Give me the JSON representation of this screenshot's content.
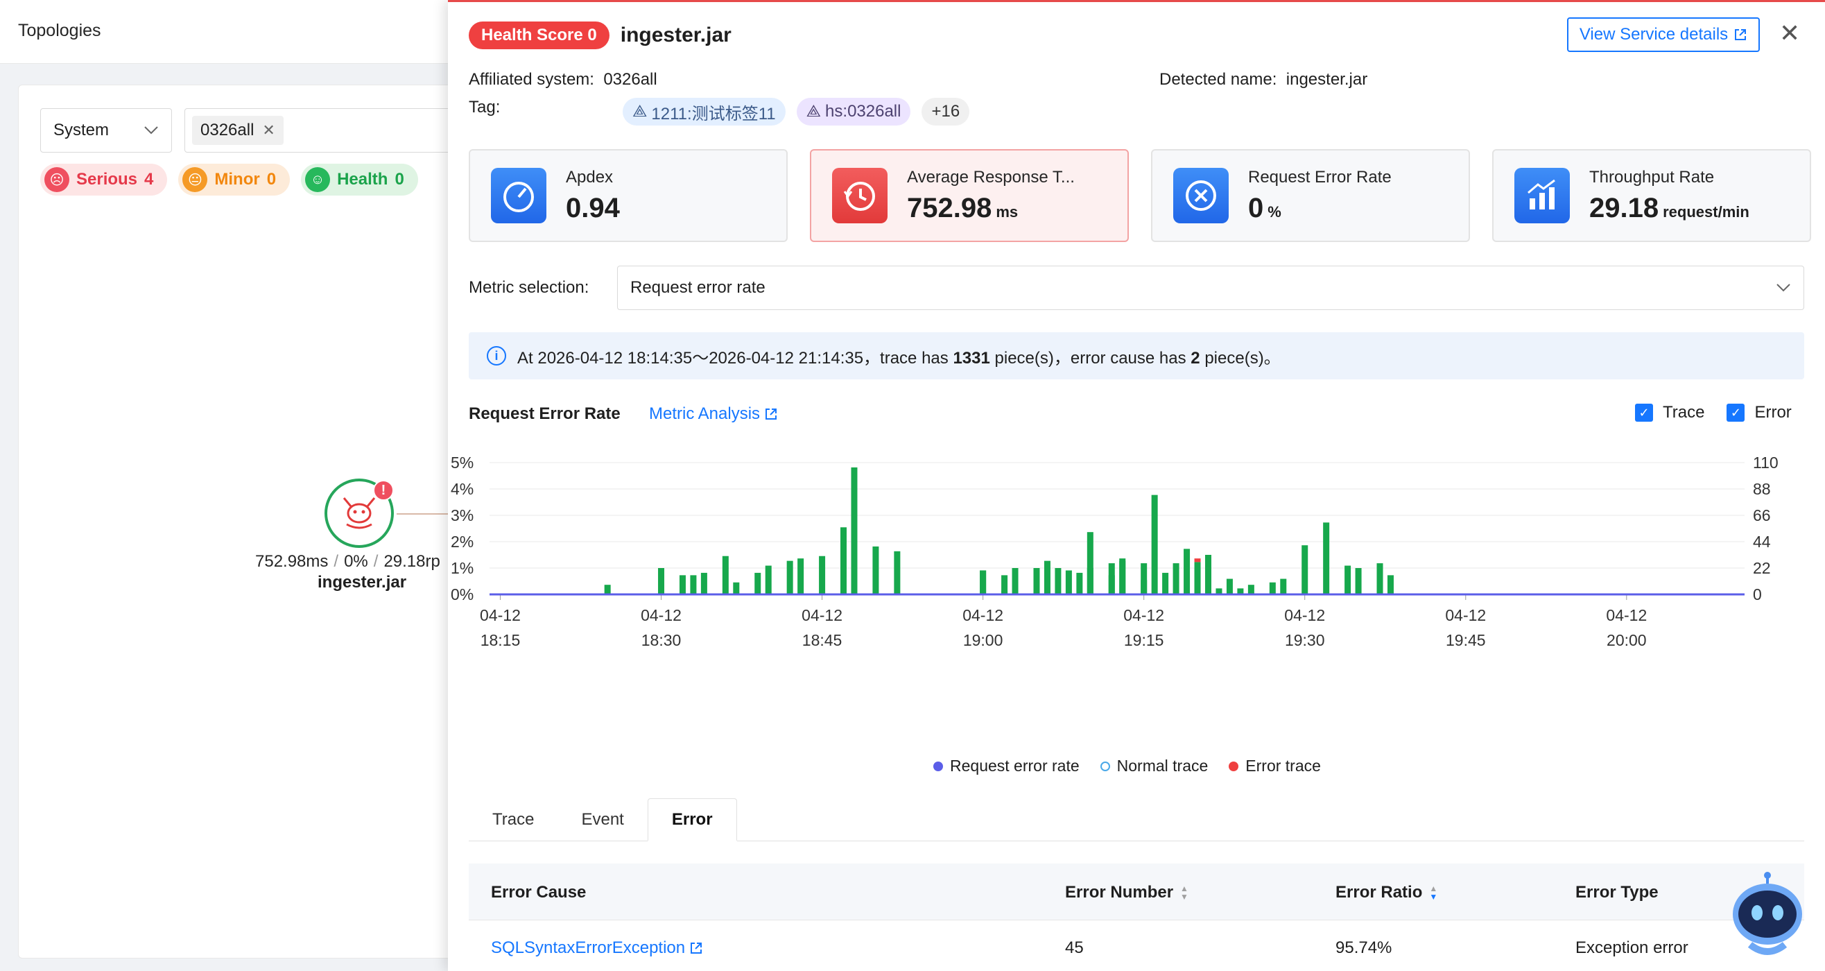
{
  "left": {
    "title": "Topologies",
    "system_select": "System",
    "tag_chip": "0326all",
    "statuses": [
      {
        "label": "Serious",
        "count": "4"
      },
      {
        "label": "Minor",
        "count": "0"
      },
      {
        "label": "Health",
        "count": "0"
      }
    ],
    "node": {
      "metrics_ms": "752.98ms",
      "metrics_err": "0%",
      "metrics_tp": "29.18rp",
      "name": "ingester.jar"
    }
  },
  "drawer": {
    "health_badge": "Health Score 0",
    "service_title": "ingester.jar",
    "view_button": "View Service details",
    "affiliated_label": "Affiliated system:",
    "affiliated_value": "0326all",
    "detected_label": "Detected name:",
    "detected_value": "ingester.jar",
    "tag_label": "Tag:",
    "tags": [
      "1211:测试标签11",
      "hs:0326all",
      "+16"
    ],
    "cards": [
      {
        "label": "Apdex",
        "value": "0.94",
        "unit": ""
      },
      {
        "label": "Average Response T...",
        "value": "752.98",
        "unit": "ms"
      },
      {
        "label": "Request Error Rate",
        "value": "0",
        "unit": "%"
      },
      {
        "label": "Throughput Rate",
        "value": "29.18",
        "unit": "request/min"
      }
    ],
    "metric_label": "Metric selection:",
    "metric_value": "Request error rate",
    "banner": {
      "prefix": "At 2026-04-12 18:14:35～2026-04-12 21:14:35，trace has",
      "trace_count": "1331",
      "middle": "piece(s)，error cause has",
      "error_count": "2",
      "suffix": "piece(s)。"
    },
    "chart_title": "Request Error Rate",
    "chart_link": "Metric Analysis",
    "checks": [
      "Trace",
      "Error"
    ],
    "legend": [
      "Request error rate",
      "Normal trace",
      "Error trace"
    ],
    "tabs": [
      "Trace",
      "Event",
      "Error"
    ],
    "table": {
      "headers": [
        "Error Cause",
        "Error Number",
        "Error Ratio",
        "Error Type"
      ],
      "rows": [
        [
          "SQLSyntaxErrorException",
          "45",
          "95.74%",
          "Exception error"
        ]
      ]
    }
  },
  "colors": {
    "accent": "#1677ff",
    "bar": "#17a84c",
    "error": "#ef4040",
    "rate_line": "#5b5ee8"
  },
  "chart_data": {
    "type": "bar",
    "y_left": {
      "ticks": [
        "0%",
        "1%",
        "2%",
        "3%",
        "4%",
        "5%"
      ],
      "range": [
        0,
        5
      ]
    },
    "y_right": {
      "ticks": [
        "0",
        "22",
        "44",
        "66",
        "88",
        "110"
      ],
      "range": [
        0,
        110
      ]
    },
    "x_ticks": [
      [
        "04-12",
        "18:15"
      ],
      [
        "04-12",
        "18:30"
      ],
      [
        "04-12",
        "18:45"
      ],
      [
        "04-12",
        "19:00"
      ],
      [
        "04-12",
        "19:15"
      ],
      [
        "04-12",
        "19:30"
      ],
      [
        "04-12",
        "19:45"
      ],
      [
        "04-12",
        "20:00"
      ]
    ],
    "x_minutes": {
      "start": "18:14",
      "end": "20:11"
    },
    "normal_trace": [
      [
        18.25,
        8
      ],
      [
        18.3,
        22
      ],
      [
        18.32,
        16
      ],
      [
        18.33,
        16
      ],
      [
        18.34,
        18
      ],
      [
        18.36,
        32
      ],
      [
        18.37,
        10
      ],
      [
        18.39,
        18
      ],
      [
        18.4,
        24
      ],
      [
        18.42,
        28
      ],
      [
        18.43,
        30
      ],
      [
        18.45,
        32
      ],
      [
        18.47,
        56
      ],
      [
        18.48,
        106
      ],
      [
        18.5,
        40
      ],
      [
        18.52,
        36
      ],
      [
        18.6,
        20
      ],
      [
        18.62,
        3
      ],
      [
        18.66,
        28
      ],
      [
        18.69,
        18
      ],
      [
        18.7,
        52
      ],
      [
        18.72,
        16
      ],
      [
        18.73,
        30
      ],
      [
        18.75,
        12
      ],
      [
        18.77,
        18
      ],
      [
        18.79,
        38
      ],
      [
        18.8,
        22
      ],
      [
        18.82,
        5
      ],
      [
        18.84,
        5
      ],
      [
        18.85,
        8
      ],
      [
        18.87,
        10
      ],
      [
        18.88,
        13
      ],
      [
        18.9,
        41
      ],
      [
        18.92,
        60
      ],
      [
        18.94,
        24
      ],
      [
        18.95,
        22
      ],
      [
        18.97,
        26
      ],
      [
        18.98,
        16
      ],
      [
        19.0,
        20
      ],
      [
        19.02,
        16
      ],
      [
        19.03,
        22
      ],
      [
        19.05,
        22
      ],
      [
        19.07,
        22
      ],
      [
        19.08,
        20
      ],
      [
        19.1,
        22
      ],
      [
        19.12,
        26
      ],
      [
        19.13,
        28
      ],
      [
        19.15,
        26
      ],
      [
        19.16,
        83
      ],
      [
        19.18,
        26
      ],
      [
        19.2,
        27
      ],
      [
        19.21,
        33
      ],
      [
        19.23,
        13
      ]
    ],
    "error_trace": [
      [
        19.2,
        1
      ]
    ]
  }
}
